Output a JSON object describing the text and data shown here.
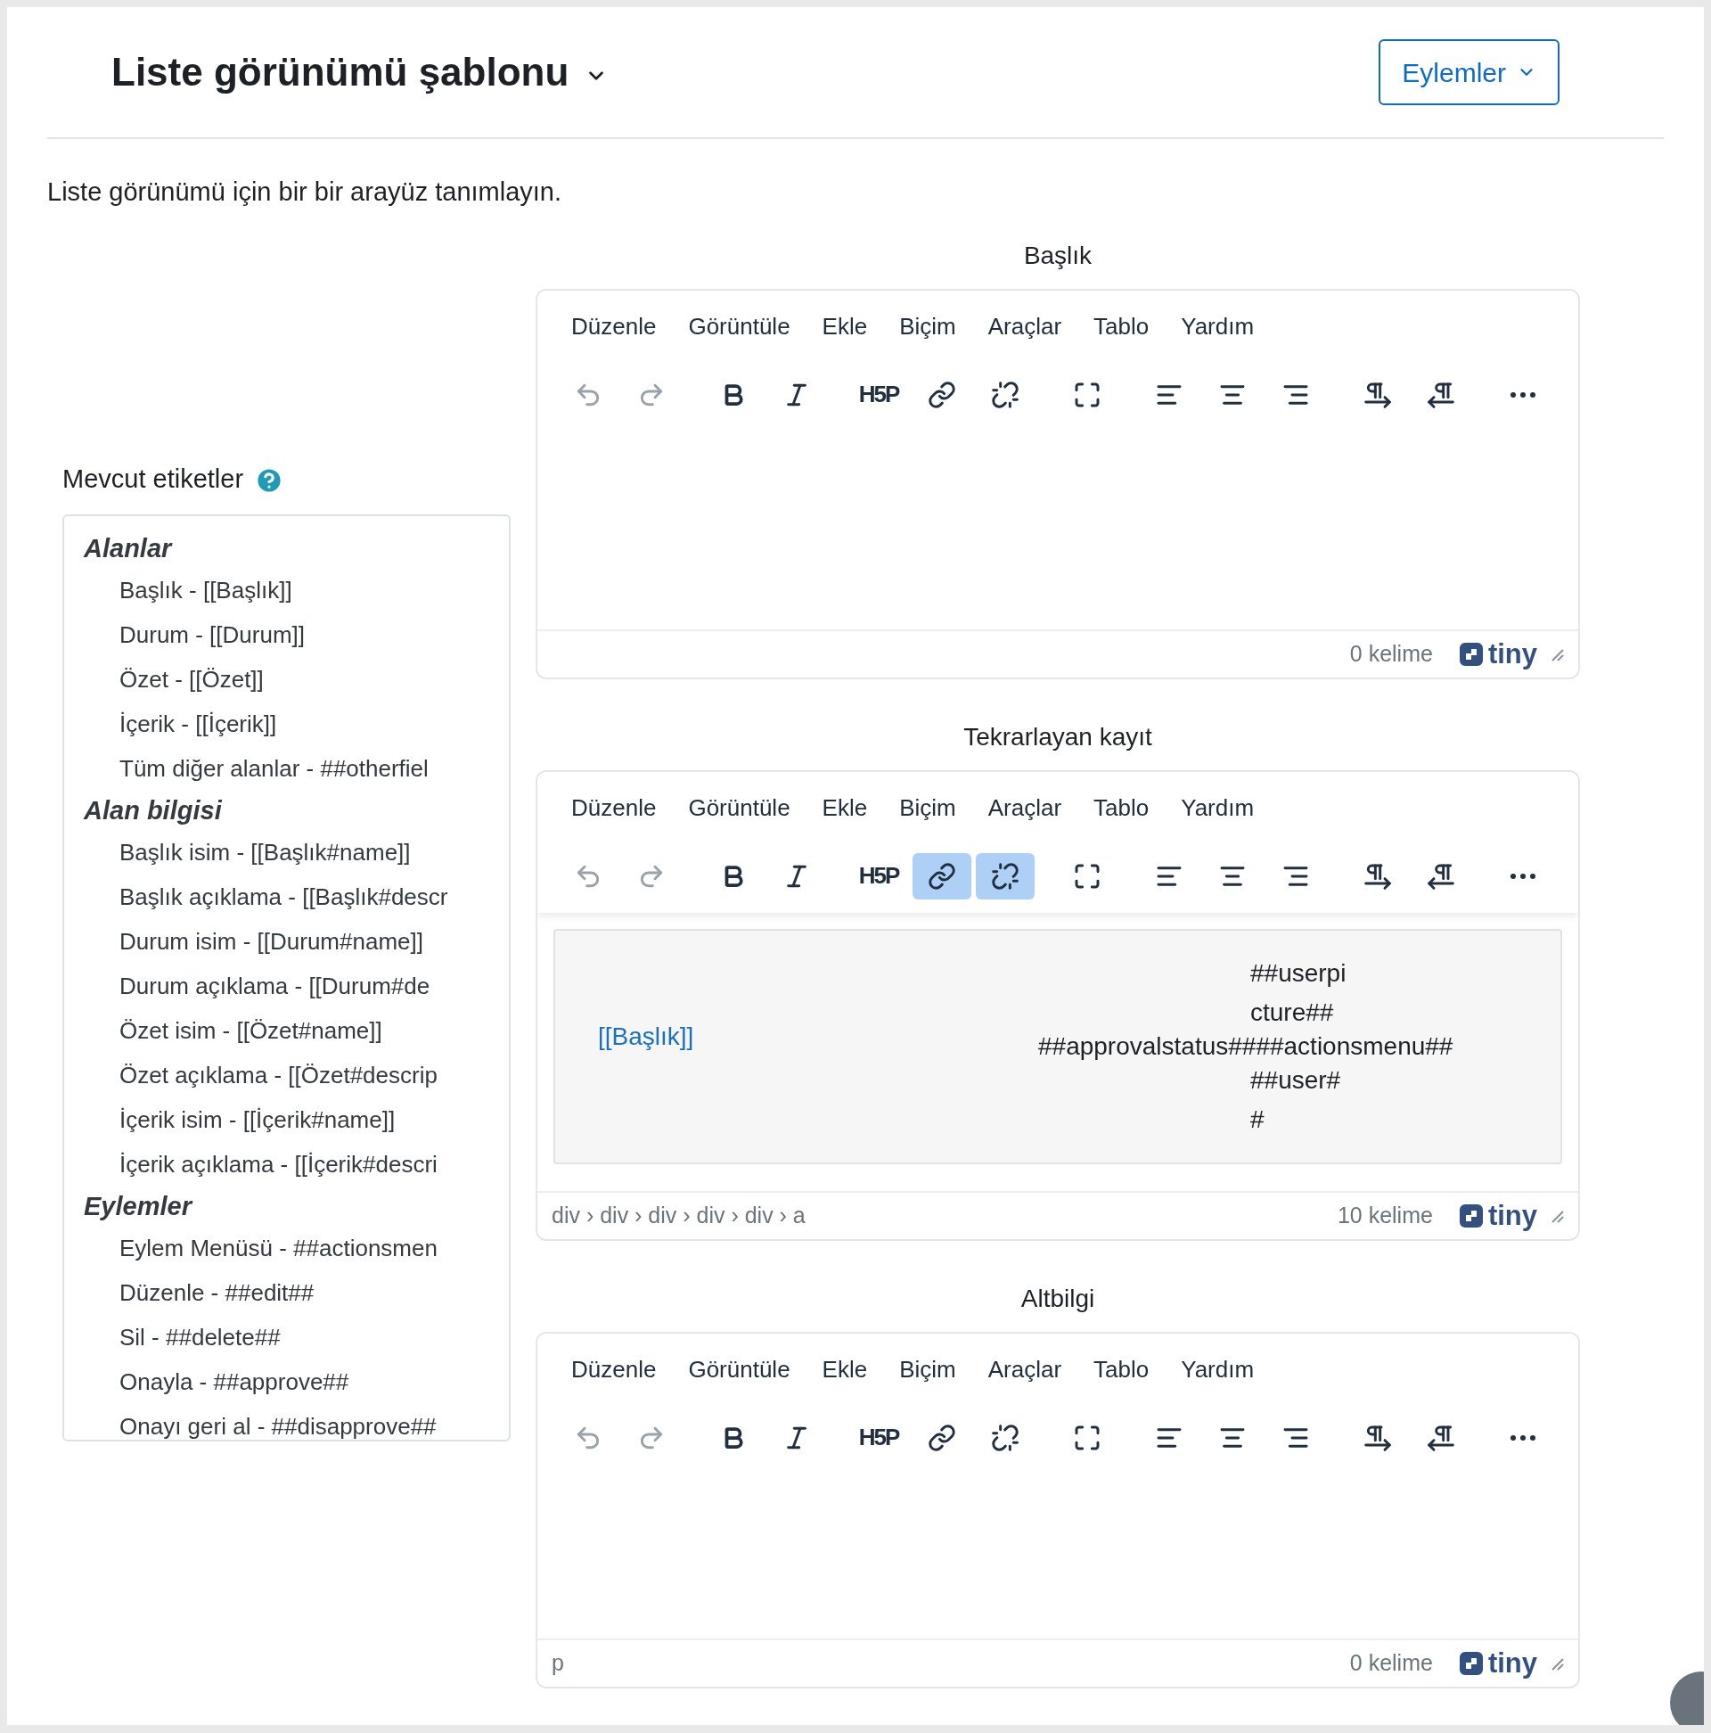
{
  "header": {
    "title": "Liste görünümü şablonu",
    "actions_button": "Eylemler"
  },
  "description": "Liste görünümü için bir bir arayüz tanımlayın.",
  "tags_panel": {
    "label": "Mevcut etiketler",
    "groups": [
      {
        "title": "Alanlar",
        "items": [
          "Başlık - [[Başlık]]",
          "Durum - [[Durum]]",
          "Özet - [[Özet]]",
          "İçerik - [[İçerik]]",
          "Tüm diğer alanlar - ##otherfiel"
        ]
      },
      {
        "title": "Alan bilgisi",
        "items": [
          "Başlık isim - [[Başlık#name]]",
          "Başlık açıklama - [[Başlık#descr",
          "Durum isim - [[Durum#name]]",
          "Durum açıklama - [[Durum#de",
          "Özet isim - [[Özet#name]]",
          "Özet açıklama - [[Özet#descrip",
          "İçerik isim - [[İçerik#name]]",
          "İçerik açıklama - [[İçerik#descri"
        ]
      },
      {
        "title": "Eylemler",
        "items": [
          "Eylem Menüsü - ##actionsmen",
          "Düzenle - ##edit##",
          "Sil - ##delete##",
          "Onayla - ##approve##",
          "Onayı geri al - ##disapprove##"
        ]
      }
    ]
  },
  "editors": [
    {
      "label": "Başlık",
      "menu": [
        "Düzenle",
        "Görüntüle",
        "Ekle",
        "Biçim",
        "Araçlar",
        "Tablo",
        "Yardım"
      ],
      "toolbar": [
        [
          {
            "kind": "undo",
            "disabled": true
          },
          {
            "kind": "redo",
            "disabled": true
          }
        ],
        [
          {
            "kind": "bold",
            "disabled": false
          },
          {
            "kind": "italic",
            "disabled": false
          }
        ],
        [
          {
            "kind": "h5p",
            "label": "H5P",
            "disabled": false
          },
          {
            "kind": "link",
            "disabled": false,
            "active": false
          },
          {
            "kind": "unlink",
            "disabled": false,
            "active": false
          }
        ],
        [
          {
            "kind": "fullscreen",
            "disabled": false
          }
        ],
        [
          {
            "kind": "align-left",
            "disabled": false
          },
          {
            "kind": "align-center",
            "disabled": false
          },
          {
            "kind": "align-right",
            "disabled": false
          }
        ],
        [
          {
            "kind": "ltr",
            "disabled": false
          },
          {
            "kind": "rtl",
            "disabled": false
          }
        ],
        [
          {
            "kind": "more",
            "disabled": false
          }
        ]
      ],
      "content": {
        "kind": "empty"
      },
      "word_count": "0 kelime",
      "brand": "tiny"
    },
    {
      "label": "Tekrarlayan kayıt",
      "menu": [
        "Düzenle",
        "Görüntüle",
        "Ekle",
        "Biçim",
        "Araçlar",
        "Tablo",
        "Yardım"
      ],
      "toolbar": [
        [
          {
            "kind": "undo",
            "disabled": true
          },
          {
            "kind": "redo",
            "disabled": true
          }
        ],
        [
          {
            "kind": "bold",
            "disabled": false
          },
          {
            "kind": "italic",
            "disabled": false
          }
        ],
        [
          {
            "kind": "h5p",
            "label": "H5P",
            "disabled": false
          },
          {
            "kind": "link",
            "disabled": false,
            "active": true
          },
          {
            "kind": "unlink",
            "disabled": false,
            "active": true
          }
        ],
        [
          {
            "kind": "fullscreen",
            "disabled": false
          }
        ],
        [
          {
            "kind": "align-left",
            "disabled": false
          },
          {
            "kind": "align-center",
            "disabled": false
          },
          {
            "kind": "align-right",
            "disabled": false
          }
        ],
        [
          {
            "kind": "ltr",
            "disabled": false
          },
          {
            "kind": "rtl",
            "disabled": false
          }
        ],
        [
          {
            "kind": "more",
            "disabled": false
          }
        ]
      ],
      "content": {
        "kind": "entry",
        "link": "[[Başlık]]",
        "user_tags": [
          "##userpicture##",
          "##user##"
        ],
        "status_line": "##approvalstatus####actionsmenu##"
      },
      "path": "div › div › div › div › div › a",
      "word_count": "10 kelime",
      "brand": "tiny"
    },
    {
      "label": "Altbilgi",
      "menu": [
        "Düzenle",
        "Görüntüle",
        "Ekle",
        "Biçim",
        "Araçlar",
        "Tablo",
        "Yardım"
      ],
      "toolbar": [
        [
          {
            "kind": "undo",
            "disabled": true
          },
          {
            "kind": "redo",
            "disabled": true
          }
        ],
        [
          {
            "kind": "bold",
            "disabled": false
          },
          {
            "kind": "italic",
            "disabled": false
          }
        ],
        [
          {
            "kind": "h5p",
            "label": "H5P",
            "disabled": false
          },
          {
            "kind": "link",
            "disabled": false,
            "active": false
          },
          {
            "kind": "unlink",
            "disabled": false,
            "active": false
          }
        ],
        [
          {
            "kind": "fullscreen",
            "disabled": false
          }
        ],
        [
          {
            "kind": "align-left",
            "disabled": false
          },
          {
            "kind": "align-center",
            "disabled": false
          },
          {
            "kind": "align-right",
            "disabled": false
          }
        ],
        [
          {
            "kind": "ltr",
            "disabled": false
          },
          {
            "kind": "rtl",
            "disabled": false
          }
        ],
        [
          {
            "kind": "more",
            "disabled": false
          }
        ]
      ],
      "content": {
        "kind": "empty"
      },
      "path": "p",
      "word_count": "0 kelime",
      "brand": "tiny"
    }
  ]
}
